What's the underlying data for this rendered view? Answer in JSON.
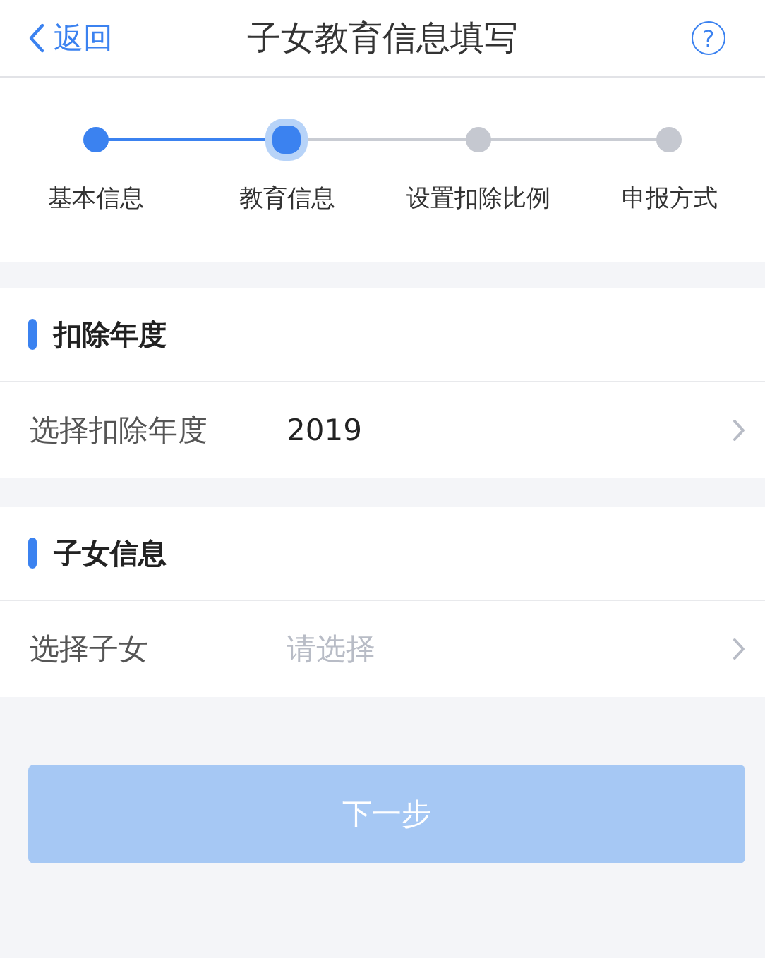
{
  "nav_bar": {
    "back": {
      "label": "返回"
    },
    "title": "子女教育信息填写",
    "help_icon": "?"
  },
  "steps": [
    {
      "label": "基本信息",
      "completed": true,
      "selected": false
    },
    {
      "label": "教育信息",
      "completed": false,
      "selected": true
    },
    {
      "label": "设置扣除比例",
      "completed": false,
      "selected": false
    },
    {
      "label": "申报方式",
      "completed": false,
      "selected": false
    }
  ],
  "sections": [
    {
      "title": "扣除年度",
      "field": {
        "label": "选择扣除年度",
        "value": "2019"
      }
    },
    {
      "title": "子女信息",
      "field": {
        "label": "选择子女",
        "placeholder": "请选择"
      }
    }
  ],
  "next_button": {
    "label": "下一步",
    "disabled": true
  }
}
